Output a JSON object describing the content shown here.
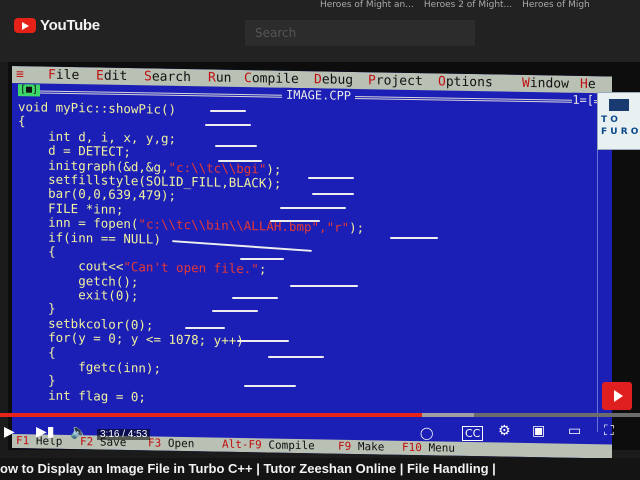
{
  "youtube": {
    "logo_text": "YouTube",
    "search_placeholder": "Search",
    "top_tabs": [
      "Heroes of Might an...",
      "Heroes 2 of Might...",
      "Heroes of Migh"
    ],
    "video_title": "ow to Display an Image File in Turbo C++ | Tutor Zeeshan Online | File Handling |",
    "time": "3:16 / 4:53",
    "progress": 0.66,
    "buffered": 0.74
  },
  "badge": {
    "lines": [
      "T O",
      "F U R O"
    ]
  },
  "ide": {
    "menu": [
      {
        "label": "≡",
        "hotkey": ""
      },
      {
        "label": "File",
        "hotkey": "F"
      },
      {
        "label": "Edit",
        "hotkey": "E"
      },
      {
        "label": "Search",
        "hotkey": "S"
      },
      {
        "label": "Run",
        "hotkey": "R"
      },
      {
        "label": "Compile",
        "hotkey": "C"
      },
      {
        "label": "Debug",
        "hotkey": "D"
      },
      {
        "label": "Project",
        "hotkey": "P"
      },
      {
        "label": "Options",
        "hotkey": "O"
      },
      {
        "label": "Window",
        "hotkey": "W"
      },
      {
        "label": "He",
        "hotkey": "H"
      }
    ],
    "window_button": "[■]",
    "file_title": "IMAGE.CPP",
    "window_number": "1=[",
    "code_lines": [
      {
        "text": "void myPic::showPic()",
        "string": ""
      },
      {
        "text": "{",
        "string": ""
      },
      {
        "text": "    int d, i, x, y,g;",
        "string": ""
      },
      {
        "text": "    d = DETECT;",
        "string": ""
      },
      {
        "text": "    initgraph(&d,&g,",
        "string": "\"c:\\\\tc\\\\bgi\"",
        "tail": ");"
      },
      {
        "text": "    setfillstyle(SOLID_FILL,BLACK);",
        "string": ""
      },
      {
        "text": "    bar(0,0,639,479);",
        "string": ""
      },
      {
        "text": "    FILE *inn;",
        "string": ""
      },
      {
        "text": "    inn = fopen(",
        "string": "\"c:\\\\tc\\\\bin\\\\ALLAH.bmp\",\"r\"",
        "tail": ");"
      },
      {
        "text": "    if(inn == NULL)",
        "string": ""
      },
      {
        "text": "    {",
        "string": ""
      },
      {
        "text": "        cout<<",
        "string": "\"Can't open file.\"",
        "tail": ";"
      },
      {
        "text": "        getch();",
        "string": ""
      },
      {
        "text": "        exit(0);",
        "string": ""
      },
      {
        "text": "    }",
        "string": ""
      },
      {
        "text": "    setbkcolor(0);",
        "string": ""
      },
      {
        "text": "    for(y = 0; y <= 1078; y++)",
        "string": ""
      },
      {
        "text": "    {",
        "string": ""
      },
      {
        "text": "        fgetc(inn);",
        "string": ""
      },
      {
        "text": "    }",
        "string": ""
      },
      {
        "text": "    int flag = 0;",
        "string": ""
      }
    ],
    "status": [
      {
        "key": "F1",
        "label": "Help"
      },
      {
        "key": "F2",
        "label": "Save"
      },
      {
        "key": "F3",
        "label": "Open"
      },
      {
        "key": "Alt-F9",
        "label": "Compile"
      },
      {
        "key": "F9",
        "label": "Make"
      },
      {
        "key": "F10",
        "label": "Menu"
      }
    ]
  },
  "colors": {
    "ide_bg": "#1b1fb5",
    "code": "#f1f1a0",
    "string": "#e53935",
    "menu_bg": "#b9c0b4",
    "progress": "#e6241a"
  }
}
